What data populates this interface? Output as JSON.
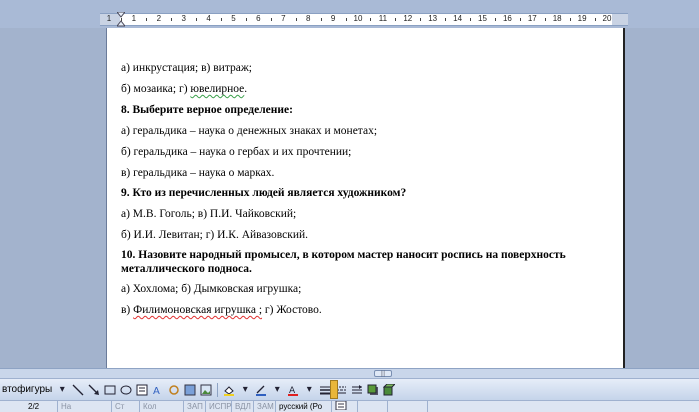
{
  "ruler": {
    "numbers": [
      "1",
      "1",
      "2",
      "3",
      "4",
      "5",
      "6",
      "7",
      "8",
      "9",
      "10",
      "11",
      "12",
      "13",
      "14",
      "15",
      "16",
      "17",
      "18",
      "19",
      "20"
    ]
  },
  "document": {
    "lines": [
      {
        "text": "а) инкрустация; в) витраж;",
        "bold": false
      },
      {
        "pre": "б) мозаика; г) ",
        "squiggle": "ювелирное",
        "post": ".",
        "bold": false
      },
      {
        "text": "8. Выберите верное определение:",
        "bold": true
      },
      {
        "text": "а) геральдика – наука о денежных знаках и монетах;",
        "bold": false
      },
      {
        "text": "б) геральдика – наука о гербах и их прочтении;",
        "bold": false
      },
      {
        "text": "в) геральдика – наука о марках.",
        "bold": false
      },
      {
        "text": "9. Кто из перечисленных людей является художником?",
        "bold": true
      },
      {
        "text": "а) М.В. Гоголь; в) П.И. Чайковский;",
        "bold": false
      },
      {
        "text": "б) И.И. Левитан; г) И.К. Айвазовский.",
        "bold": false
      },
      {
        "text": "10. Назовите народный промысел, в котором мастер наносит роспись на поверхность",
        "bold": true
      },
      {
        "text": "металлического подноса.",
        "bold": true
      },
      {
        "text": "а) Хохлома; б) Дымковская игрушка;",
        "bold": false
      },
      {
        "pre": "в) ",
        "squiggle": "Филимоновская игрушка ;",
        "post": " г) Жостово.",
        "bold": false
      }
    ]
  },
  "toolbar": {
    "autoshapes_label": "втофигуры"
  },
  "status": {
    "page": "2/2",
    "at": "На",
    "line": "Ст",
    "col": "Кол",
    "rec": "ЗАП",
    "trk": "ИСПР",
    "ext": "ВДЛ",
    "ovr": "ЗАМ",
    "language": "русский (Ро"
  },
  "colors": {
    "background": "#a3b3cd",
    "spell_green": "#3aa04a",
    "spell_red": "#e03030"
  }
}
